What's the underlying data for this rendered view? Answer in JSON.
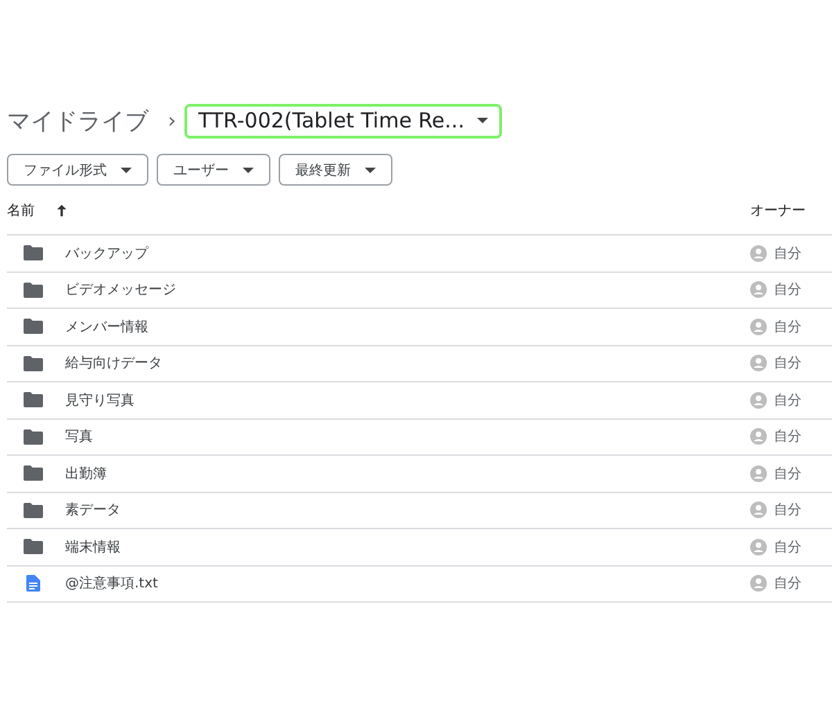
{
  "breadcrumb": {
    "root": "マイドライブ",
    "separator": "›",
    "current": {
      "label": "TTR-002(Tablet Time Re...",
      "highlighted": true
    }
  },
  "filters": [
    {
      "label": "ファイル形式"
    },
    {
      "label": "ユーザー"
    },
    {
      "label": "最終更新"
    }
  ],
  "table": {
    "columns": [
      {
        "label": "名前",
        "sorted_ascending": true
      },
      {
        "label": "オーナー"
      }
    ],
    "rows": [
      {
        "kind": "folder",
        "name": "バックアップ",
        "owner": "自分"
      },
      {
        "kind": "folder",
        "name": "ビデオメッセージ",
        "owner": "自分"
      },
      {
        "kind": "folder",
        "name": "メンバー情報",
        "owner": "自分"
      },
      {
        "kind": "folder",
        "name": "給与向けデータ",
        "owner": "自分"
      },
      {
        "kind": "folder",
        "name": "見守り写真",
        "owner": "自分"
      },
      {
        "kind": "folder",
        "name": "写真",
        "owner": "自分"
      },
      {
        "kind": "folder",
        "name": "出勤簿",
        "owner": "自分"
      },
      {
        "kind": "folder",
        "name": "素データ",
        "owner": "自分"
      },
      {
        "kind": "folder",
        "name": "端末情報",
        "owner": "自分"
      },
      {
        "kind": "document",
        "name": "@注意事項.txt",
        "owner": "自分"
      }
    ]
  }
}
